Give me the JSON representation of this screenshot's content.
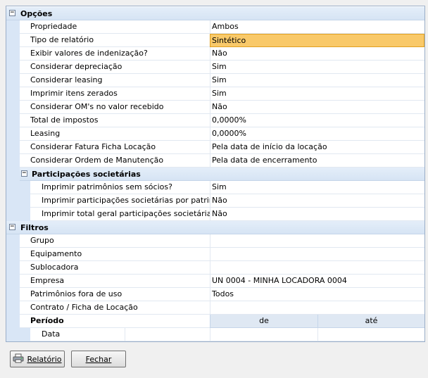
{
  "opcoes": {
    "title": "Opções",
    "rows": [
      {
        "label": "Propriedade",
        "value": "Ambos"
      },
      {
        "label": "Tipo de relatório",
        "value": "Sintético"
      },
      {
        "label": "Exibir valores de indenização?",
        "value": "Não"
      },
      {
        "label": "Considerar depreciação",
        "value": "Sim"
      },
      {
        "label": "Considerar leasing",
        "value": "Sim"
      },
      {
        "label": "Imprimir itens zerados",
        "value": "Sim"
      },
      {
        "label": "Considerar OM's no valor recebido",
        "value": "Não"
      },
      {
        "label": "Total de impostos",
        "value": "0,0000%"
      },
      {
        "label": "Leasing",
        "value": "0,0000%"
      },
      {
        "label": "Considerar Fatura Ficha Locação",
        "value": "Pela data de início da locação"
      },
      {
        "label": "Considerar Ordem de Manutenção",
        "value": "Pela data de encerramento"
      }
    ],
    "participacoes": {
      "title": "Participações societárias",
      "rows": [
        {
          "label": "Imprimir patrimônios sem sócios?",
          "value": "Sim"
        },
        {
          "label": "Imprimir participações societárias por patrimônio",
          "value": "Não"
        },
        {
          "label": "Imprimir total geral participações societárias",
          "value": "Não"
        }
      ]
    }
  },
  "filtros": {
    "title": "Filtros",
    "rows": [
      {
        "label": "Grupo",
        "value": ""
      },
      {
        "label": "Equipamento",
        "value": ""
      },
      {
        "label": "Sublocadora",
        "value": ""
      },
      {
        "label": "Empresa",
        "value": "UN 0004 - MINHA LOCADORA 0004"
      },
      {
        "label": "Patrimônios fora de uso",
        "value": "Todos"
      },
      {
        "label": "Contrato / Ficha de Locação",
        "value": ""
      }
    ],
    "periodo": {
      "label": "Período",
      "de": "de",
      "ate": "até",
      "data_label": "Data",
      "data_de": "",
      "data_ate": ""
    }
  },
  "toggle_symbol": "−",
  "buttons": {
    "relatorio": "Relatório",
    "fechar": "Fechar"
  },
  "icons": {
    "relatorio": "printer-icon"
  },
  "colors": {
    "selected_value": "#f9c969",
    "category_bg": "#d9e6f6"
  }
}
